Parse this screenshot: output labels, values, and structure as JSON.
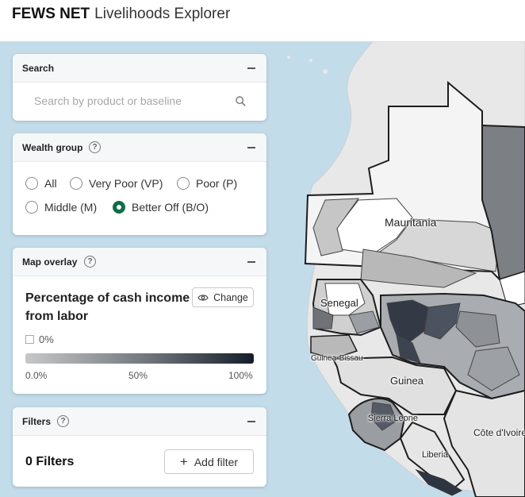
{
  "header": {
    "brand_bold": "FEWS NET",
    "brand_rest": "Livelihoods Explorer"
  },
  "search": {
    "title": "Search",
    "placeholder": "Search by product or baseline",
    "icon": "search-icon"
  },
  "wealth_group": {
    "title": "Wealth group",
    "options": [
      {
        "label": "All",
        "checked": false
      },
      {
        "label": "Very Poor (VP)",
        "checked": false
      },
      {
        "label": "Poor (P)",
        "checked": false
      },
      {
        "label": "Middle (M)",
        "checked": false
      },
      {
        "label": "Better Off (B/O)",
        "checked": true
      }
    ],
    "accent_color": "#0f6e4a"
  },
  "map_overlay": {
    "title": "Map overlay",
    "overlay_name": "Percentage of cash income from labor",
    "change_label": "Change",
    "checkbox_label": "0%",
    "scale_ticks": [
      "0.0%",
      "50%",
      "100%"
    ],
    "scale_colors": [
      "#c8c8c8",
      "#151d2b"
    ]
  },
  "filters": {
    "title": "Filters",
    "count_label": "0 Filters",
    "add_label": "Add filter"
  },
  "map": {
    "labels": [
      "Mauritania",
      "Senegal",
      "Guinea-Bissau",
      "Guinea",
      "Sierra Leone",
      "Liberia",
      "Côte d'Ivoire"
    ],
    "water_color": "#c2dcea",
    "land_color": "#e8e8e8"
  }
}
